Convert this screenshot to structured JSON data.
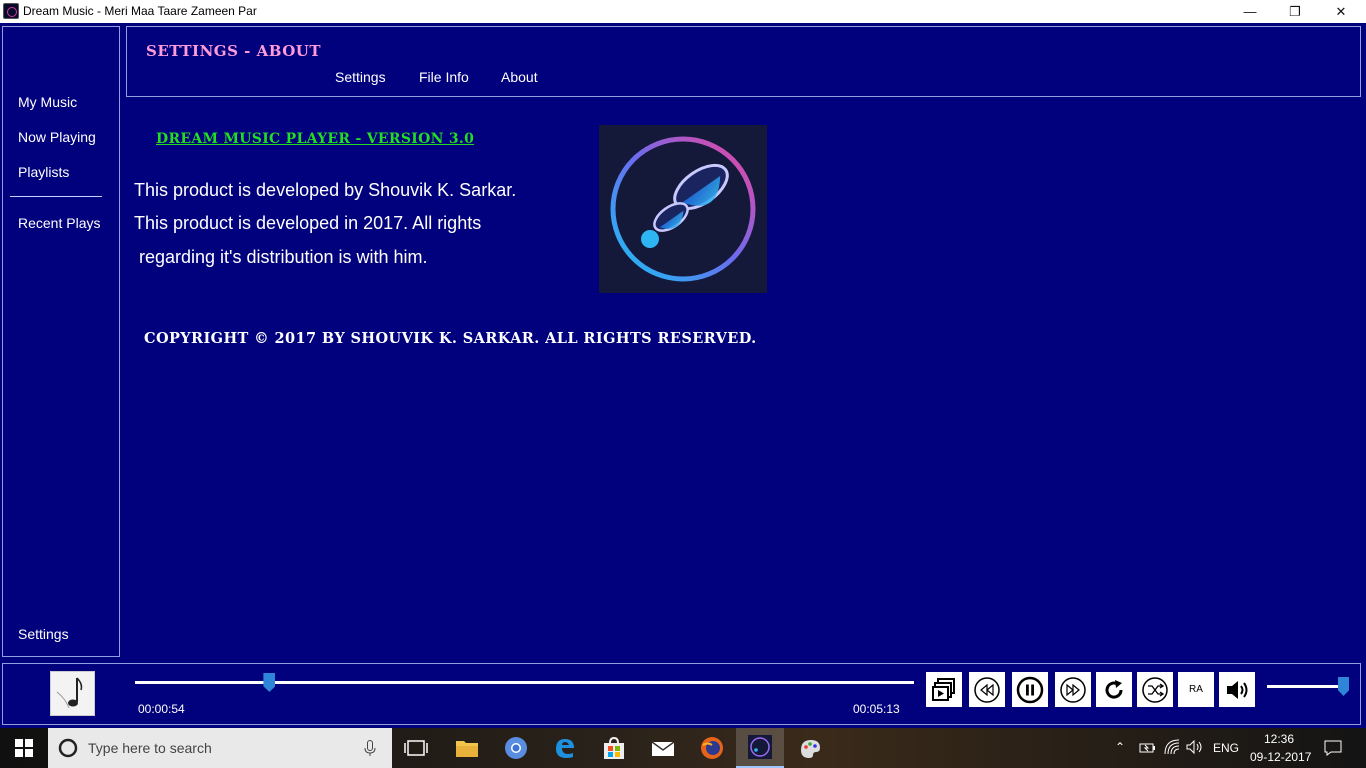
{
  "window": {
    "title": "Dream Music - Meri Maa Taare Zameen Par",
    "minimize_glyph": "—",
    "maximize_glyph": "❐",
    "close_glyph": "✕"
  },
  "sidebar": {
    "items": [
      {
        "label": "My Music"
      },
      {
        "label": "Now Playing"
      },
      {
        "label": "Playlists"
      },
      {
        "label": "Recent Plays"
      }
    ],
    "settings_label": "Settings"
  },
  "header": {
    "title": "SETTINGS - ABOUT",
    "tabs": [
      {
        "label": "Settings"
      },
      {
        "label": "File Info"
      },
      {
        "label": "About"
      }
    ]
  },
  "about": {
    "heading": "DREAM MUSIC PLAYER - VERSION 3.0",
    "lines": [
      "This product is developed by Shouvik K. Sarkar.",
      "This product is developed in 2017. All rights",
      " regarding it's distribution is with him."
    ],
    "copyright": "COPYRIGHT © 2017 BY SHOUVIK K. SARKAR. ALL RIGHTS RESERVED."
  },
  "player": {
    "elapsed": "00:00:54",
    "duration": "00:05:13",
    "seek_fraction": 0.1725,
    "volume_fraction": 1.0,
    "buttons": [
      {
        "name": "playlist-queue-icon"
      },
      {
        "name": "previous-icon"
      },
      {
        "name": "pause-icon"
      },
      {
        "name": "next-icon"
      },
      {
        "name": "repeat-icon"
      },
      {
        "name": "shuffle-icon"
      },
      {
        "name": "ra-button",
        "label": "RA"
      },
      {
        "name": "volume-icon"
      }
    ]
  },
  "taskbar": {
    "search_placeholder": "Type here to search",
    "language": "ENG",
    "time": "12:36",
    "date": "09-12-2017"
  },
  "colors": {
    "background": "#01017d",
    "accent_blue": "#2f86d8",
    "title_pink": "#ff9bd8",
    "heading_green": "#22dd22"
  }
}
